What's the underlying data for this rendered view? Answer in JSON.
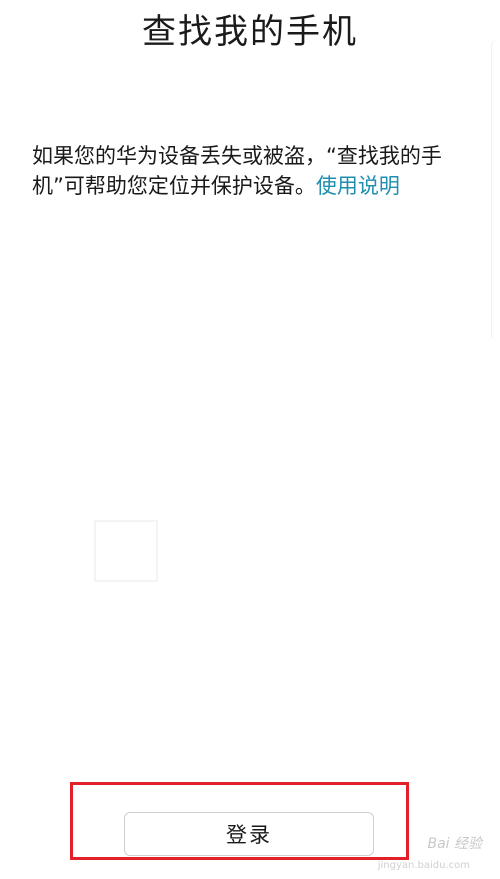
{
  "page": {
    "title": "查找我的手机",
    "description": "如果您的华为设备丢失或被盗，“查找我的手机”可帮助您定位并保护设备。",
    "help_link": "使用说明"
  },
  "login": {
    "label": "登录"
  },
  "watermark": {
    "brand": "Bai 经验",
    "url": "jingyan.baidu.com"
  }
}
